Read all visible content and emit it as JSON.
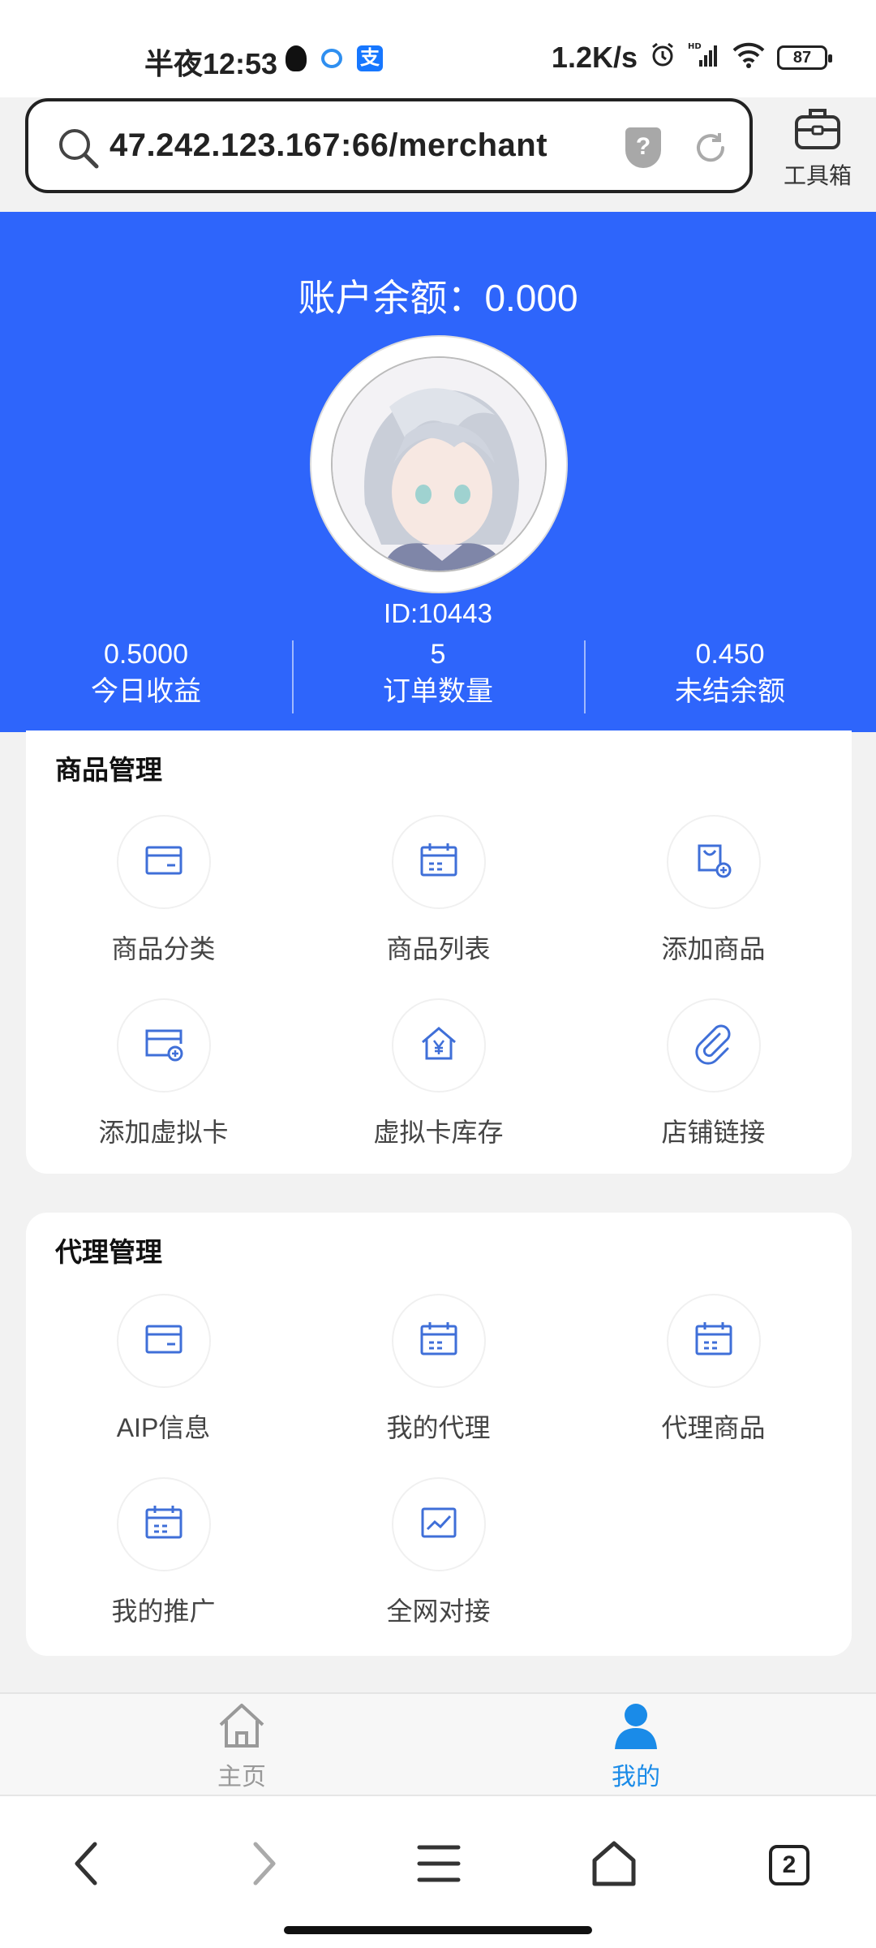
{
  "status_bar": {
    "time": "半夜12:53",
    "net_speed": "1.2K/s",
    "battery": "87",
    "app_alipay_glyph": "支",
    "icons": [
      "qq-icon",
      "messages-icon",
      "alipay-icon",
      "alarm-icon",
      "hd-signal-icon",
      "wifi-icon",
      "battery-icon"
    ]
  },
  "browser": {
    "url": "47.242.123.167:66/merchant",
    "security_badge": "?",
    "toolbox_label": "工具箱",
    "tabs_count": "2"
  },
  "header": {
    "balance": "账户余额：0.000",
    "user_id": "ID:10443",
    "stats": [
      {
        "value": "0.5000",
        "label": "今日收益"
      },
      {
        "value": "5",
        "label": "订单数量"
      },
      {
        "value": "0.450",
        "label": "未结余额"
      }
    ]
  },
  "goods_section": {
    "title": "商品管理",
    "items": [
      {
        "label": "商品分类",
        "icon": "card-icon"
      },
      {
        "label": "商品列表",
        "icon": "calendar-icon"
      },
      {
        "label": "添加商品",
        "icon": "add-bag-icon"
      },
      {
        "label": "添加虚拟卡",
        "icon": "add-card-icon"
      },
      {
        "label": "虚拟卡库存",
        "icon": "yuan-house-icon"
      },
      {
        "label": "店铺链接",
        "icon": "paperclip-icon"
      }
    ]
  },
  "agent_section": {
    "title": "代理管理",
    "items": [
      {
        "label": "AIP信息",
        "icon": "card-icon"
      },
      {
        "label": "我的代理",
        "icon": "calendar-icon"
      },
      {
        "label": "代理商品",
        "icon": "calendar-icon"
      },
      {
        "label": "我的推广",
        "icon": "calendar-icon"
      },
      {
        "label": "全网对接",
        "icon": "chart-icon"
      }
    ]
  },
  "tabbar": {
    "home": "主页",
    "mine": "我的"
  },
  "colors": {
    "primary_blue": "#2e65fb",
    "icon_blue": "#3f6fd8",
    "active_tab": "#1a8be8"
  }
}
